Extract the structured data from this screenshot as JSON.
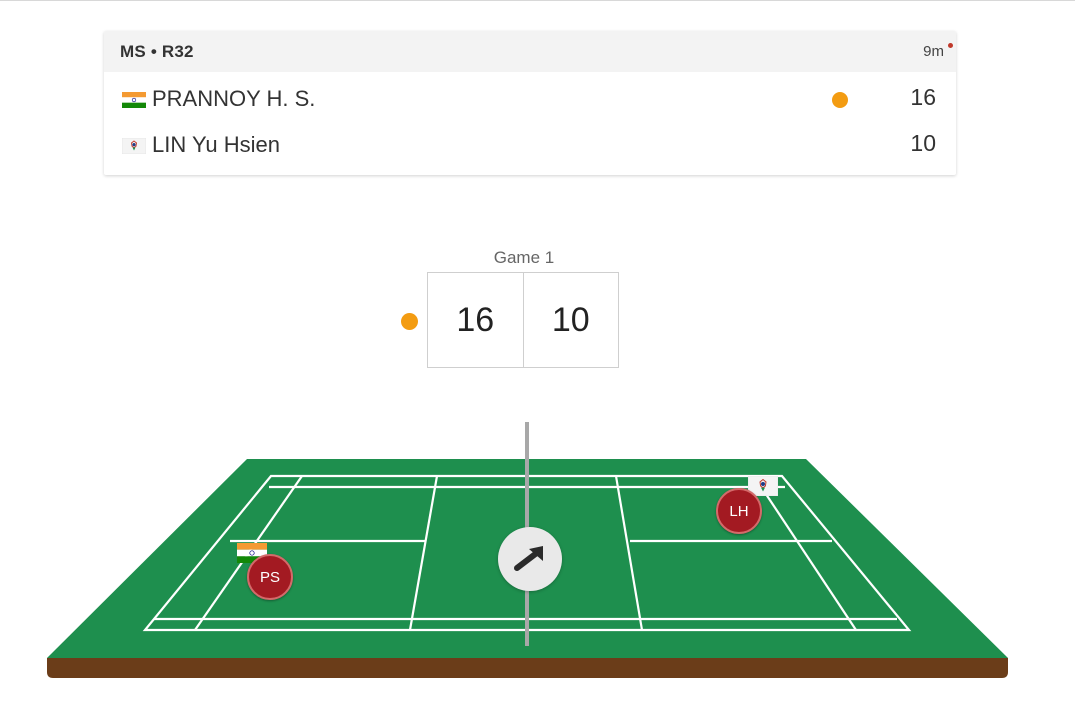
{
  "match": {
    "event": "MS • R32",
    "time": "9m",
    "players": [
      {
        "name": "PRANNOY H. S.",
        "flag": "india-flag-icon",
        "score": "16",
        "serving": true
      },
      {
        "name": "LIN Yu Hsien",
        "flag": "chinese-taipei-flag-icon",
        "score": "10",
        "serving": false
      }
    ]
  },
  "game": {
    "label": "Game 1",
    "score_left": "16",
    "score_right": "10"
  },
  "court": {
    "player_left": {
      "initials": "PS",
      "flag": "india-flag-icon"
    },
    "player_right": {
      "initials": "LH",
      "flag": "chinese-taipei-flag-icon"
    },
    "direction_icon": "arrow-up-right-icon"
  },
  "colors": {
    "court_green": "#1e8f4e",
    "court_base": "#6b3d19",
    "player_marker": "#a31a22",
    "serve_indicator": "#f39c12",
    "live_indicator": "#c0392b"
  }
}
